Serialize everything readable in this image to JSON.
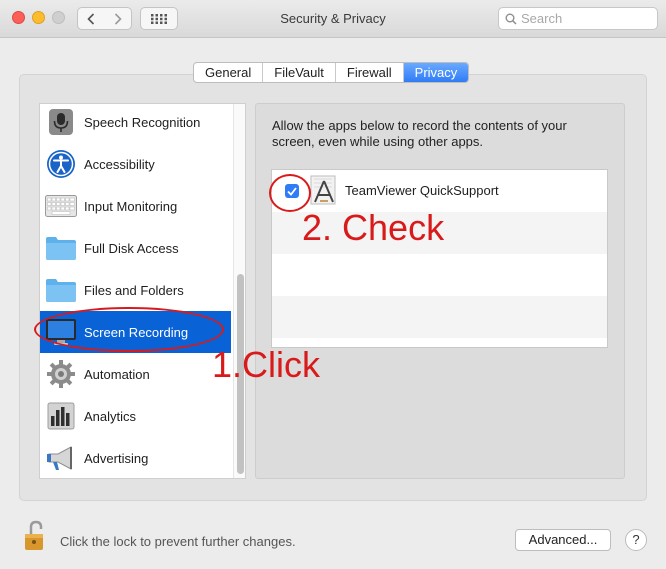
{
  "window": {
    "title": "Security & Privacy",
    "search_placeholder": "Search"
  },
  "tabs": [
    {
      "label": "General"
    },
    {
      "label": "FileVault"
    },
    {
      "label": "Firewall"
    },
    {
      "label": "Privacy",
      "active": true
    }
  ],
  "sidebar": {
    "items": [
      {
        "label": "Speech Recognition",
        "icon": "microphone-icon"
      },
      {
        "label": "Accessibility",
        "icon": "accessibility-icon"
      },
      {
        "label": "Input Monitoring",
        "icon": "keyboard-icon"
      },
      {
        "label": "Full Disk Access",
        "icon": "folder-icon"
      },
      {
        "label": "Files and Folders",
        "icon": "folder-icon"
      },
      {
        "label": "Screen Recording",
        "icon": "display-icon",
        "selected": true
      },
      {
        "label": "Automation",
        "icon": "gear-icon"
      },
      {
        "label": "Analytics",
        "icon": "analytics-icon"
      },
      {
        "label": "Advertising",
        "icon": "megaphone-icon"
      }
    ]
  },
  "main": {
    "description": "Allow the apps below to record the contents of your screen, even while using other apps.",
    "apps": [
      {
        "name": "TeamViewer QuickSupport",
        "checked": true
      }
    ]
  },
  "annotations": {
    "click": "1.Click",
    "check": "2. Check"
  },
  "footer": {
    "lock_text": "Click the lock to prevent further changes.",
    "advanced_label": "Advanced...",
    "help_label": "?"
  },
  "colors": {
    "accent": "#0a63d6",
    "annotation": "#d91a1a"
  }
}
